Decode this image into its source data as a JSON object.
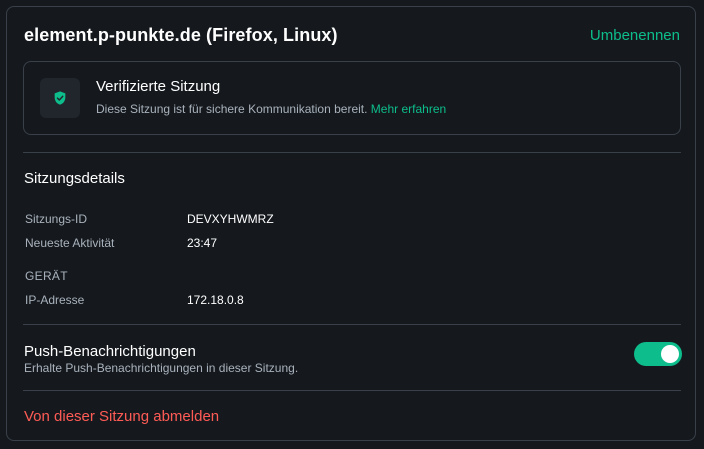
{
  "session": {
    "title": "element.p-punkte.de (Firefox, Linux)",
    "rename_label": "Umbenennen"
  },
  "verification": {
    "heading": "Verifizierte Sitzung",
    "description": "Diese Sitzung ist für sichere Kommunikation bereit.",
    "learn_more": "Mehr erfahren",
    "icon": "shield-check-icon",
    "accent_color": "#0dbd8b"
  },
  "details": {
    "heading": "Sitzungsdetails",
    "rows": [
      {
        "label": "Sitzungs-ID",
        "value": "DEVXYHWMRZ"
      },
      {
        "label": "Neueste Aktivität",
        "value": "23:47"
      }
    ],
    "device_heading": "GERÄT",
    "device_rows": [
      {
        "label": "IP-Adresse",
        "value": "172.18.0.8"
      }
    ]
  },
  "push": {
    "heading": "Push-Benachrichtigungen",
    "description": "Erhalte Push-Benachrichtigungen in dieser Sitzung.",
    "enabled": true
  },
  "signout": {
    "label": "Von dieser Sitzung abmelden",
    "color": "#ff5b55"
  }
}
